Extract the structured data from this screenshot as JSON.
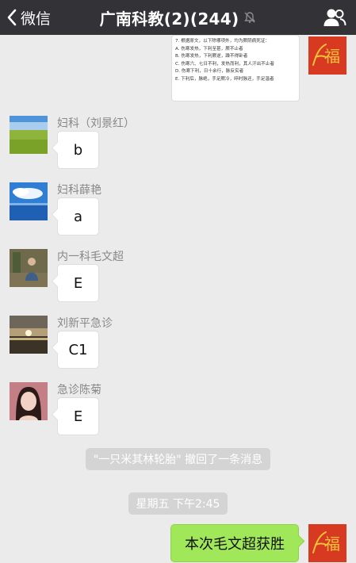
{
  "navbar": {
    "back_label": "微信",
    "title": "广南科教(2)(244)"
  },
  "image_message": {
    "lines": [
      "7. 根据原文，以下除哪项外，均为厥阴病死证：",
      "A. 伤寒发热，下利至甚，厥不止者",
      "B. 伤寒发热，下利厥逆，躁不得卧者",
      "C. 伤寒六、七日不利，发热而利，其人汗出不止者",
      "D. 伤寒下利，日十余行，脉反实者",
      "E. 下利后，脉绝，手足厥冷，晬时脉还，手足温者"
    ]
  },
  "messages": [
    {
      "sender": "妇科（刘景红）",
      "text": "b"
    },
    {
      "sender": "妇科薛艳",
      "text": "a"
    },
    {
      "sender": "内一科毛文超",
      "text": "E"
    },
    {
      "sender": "刘新平急诊",
      "text": "C1"
    },
    {
      "sender": "急诊陈菊",
      "text": "E"
    }
  ],
  "recall_notice": "\"一只米其林轮胎\" 撤回了一条消息",
  "timestamp": "星期五 下午2:45",
  "my_message": "本次毛文超获胜",
  "self_avatar_glyph": "福",
  "colors": {
    "navbar": "#323237",
    "chat_background": "#ebebeb",
    "outgoing_bubble": "#a0e75a",
    "avatar_red": "#d83a21"
  }
}
